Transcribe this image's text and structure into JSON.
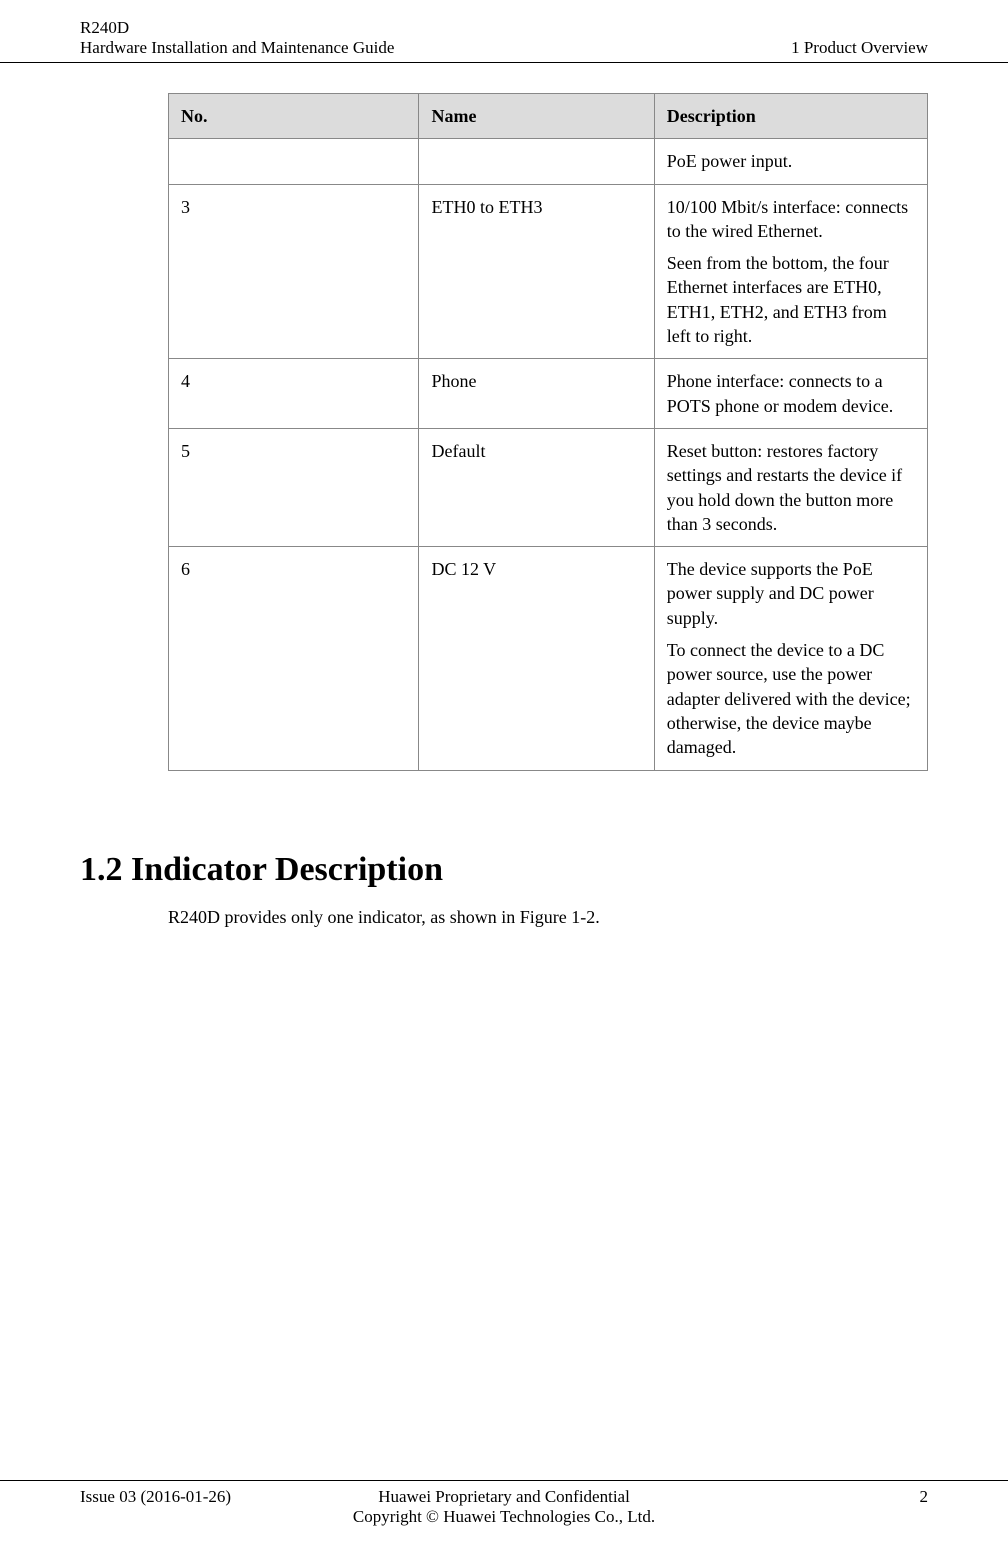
{
  "header": {
    "product": "R240D",
    "doc_title": "Hardware Installation and Maintenance Guide",
    "chapter": "1 Product Overview"
  },
  "table": {
    "headers": {
      "no": "No.",
      "name": "Name",
      "desc": "Description"
    },
    "rows": [
      {
        "no": "",
        "name": "",
        "desc": [
          "PoE power input."
        ]
      },
      {
        "no": "3",
        "name": "ETH0 to ETH3",
        "desc": [
          "10/100 Mbit/s interface: connects to the wired Ethernet.",
          "Seen from the bottom, the four Ethernet interfaces are ETH0, ETH1, ETH2, and ETH3 from left to right."
        ]
      },
      {
        "no": "4",
        "name": "Phone",
        "desc": [
          "Phone interface: connects to a POTS phone or modem device."
        ]
      },
      {
        "no": "5",
        "name": "Default",
        "desc": [
          "Reset button: restores factory settings and restarts the device if you hold down the button more than 3 seconds."
        ]
      },
      {
        "no": "6",
        "name": "DC 12 V",
        "desc": [
          "The device supports the PoE power supply and DC power supply.",
          "To connect the device to a DC power source, use the power adapter delivered with the device; otherwise, the device maybe damaged."
        ]
      }
    ]
  },
  "section": {
    "heading": "1.2 Indicator Description",
    "body": "R240D provides only one indicator, as shown in Figure 1-2."
  },
  "footer": {
    "issue": "Issue 03 (2016-01-26)",
    "line1": "Huawei Proprietary and Confidential",
    "line2": "Copyright © Huawei Technologies Co., Ltd.",
    "page": "2"
  }
}
